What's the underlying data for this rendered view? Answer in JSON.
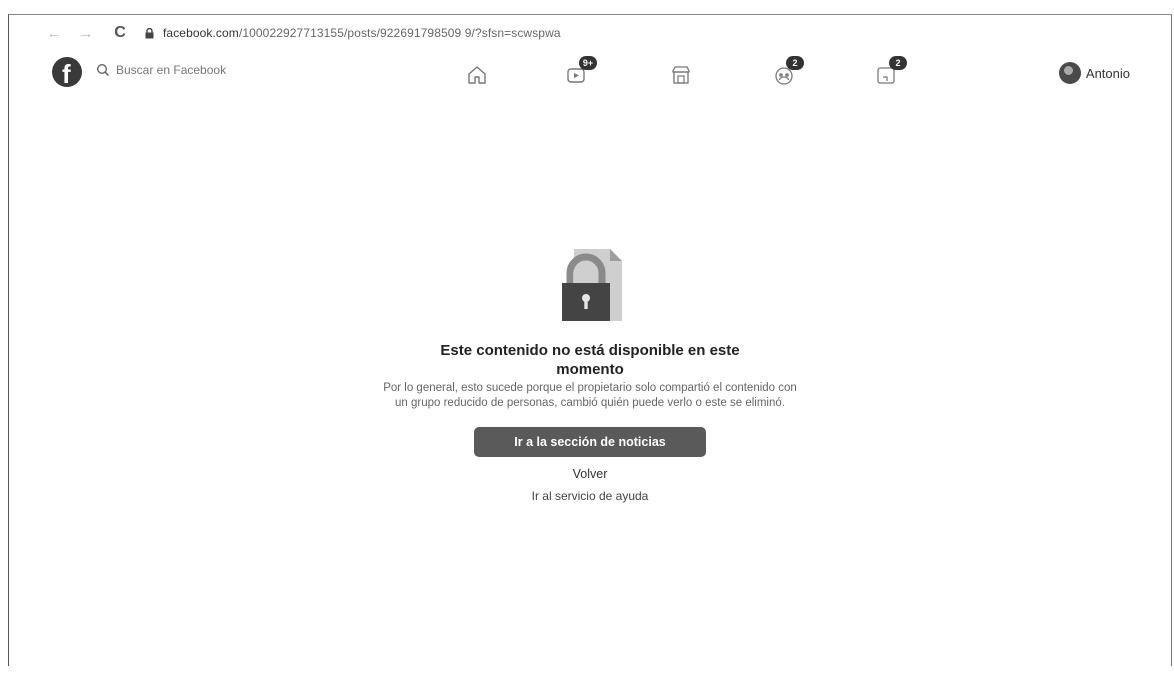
{
  "browser": {
    "url_host": "facebook.com",
    "url_path": "/100022927713155/posts/922691798509 9/?sfsn=scwspwa"
  },
  "header": {
    "search_placeholder": "Buscar en Facebook",
    "watch_badge": "9+",
    "groups_badge": "2",
    "gaming_badge": "2",
    "profile_name": "Antonio"
  },
  "main": {
    "title": "Este contenido no está disponible en este momento",
    "description": "Por lo general, esto sucede porque el propietario solo compartió el contenido con un grupo reducido de personas, cambió quién puede verlo o este se eliminó.",
    "primary_button": "Ir a la sección de noticias",
    "back_link": "Volver",
    "help_link": "Ir al servicio de ayuda"
  }
}
